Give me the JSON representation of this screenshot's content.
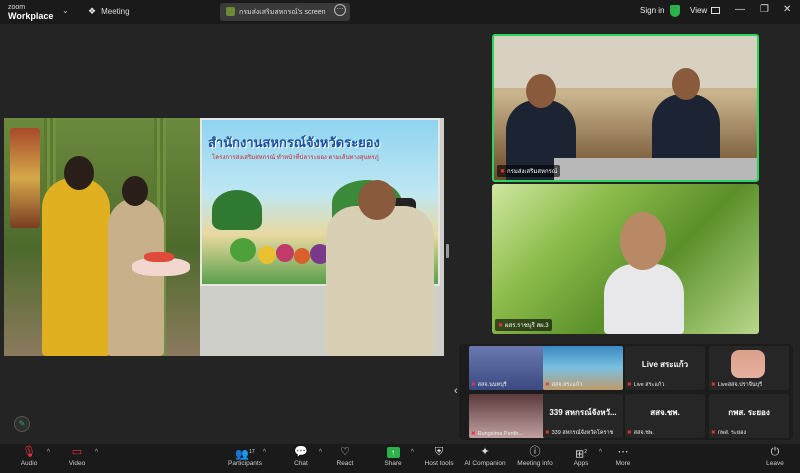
{
  "app": {
    "logo_line1": "zoom",
    "logo_line2": "Workplace"
  },
  "tabs": {
    "meeting": "Meeting",
    "share": "กรมส่งเสริมสหกรณ์'s screen"
  },
  "header": {
    "signin": "Sign in",
    "view": "View"
  },
  "shared_screen": {
    "poster_title": "สำนักงานสหกรณ์จังหวัดระยอง",
    "poster_subtitle": "โครงการส่งเสริมสหกรณ์ ทำหน้าที่ปลาระยอง ตามเส้นทางสุนทรภู่"
  },
  "participants_tiles": [
    {
      "name": "กรมส่งเสริมสหกรณ์"
    },
    {
      "name": "ผสร.ราชบุรี สผ.3"
    }
  ],
  "gallery": [
    {
      "label": "สสจ.นนทบุรี",
      "big": ""
    },
    {
      "label": "สสจ.สระแก้ว",
      "big": ""
    },
    {
      "label": "Live สระแก้ว",
      "big": "Live สระแก้ว"
    },
    {
      "label": "Liveสสจ.ปราจีนบุรี",
      "big": ""
    },
    {
      "label": "Rungsima Penth...",
      "big": ""
    },
    {
      "label": "339 สหกรณ์จังหวัดโคราช",
      "big": "339 สหกรณ์จังหวั..."
    },
    {
      "label": "สสจ.ชพ.",
      "big": "สสจ.ชพ."
    },
    {
      "label": "กพส. ระยอง",
      "big": "กพส. ระยอง"
    }
  ],
  "toolbar": {
    "audio": "Audio",
    "video": "Video",
    "participants": "Participants",
    "participants_count": "17",
    "chat": "Chat",
    "react": "React",
    "share": "Share",
    "host_tools": "Host tools",
    "ai_companion": "AI Companion",
    "meeting_info": "Meeting info",
    "apps": "Apps",
    "apps_count": "2",
    "more": "More",
    "leave": "Leave"
  },
  "colors": {
    "active_border": "#2bd45a",
    "share_green": "#2bb24c",
    "leave_red": "#e34"
  }
}
